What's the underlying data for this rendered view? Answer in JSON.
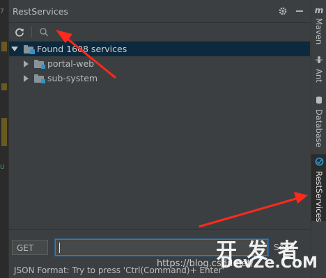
{
  "gutter": {
    "line_number": "7",
    "green_mark": "U"
  },
  "window": {
    "title": "RestServices"
  },
  "toolbar": {
    "refresh_icon": "refresh-icon",
    "search_icon": "search-icon"
  },
  "tree": {
    "root": "Found 1608 services",
    "children": [
      {
        "label": "portal-web"
      },
      {
        "label": "sub-system"
      }
    ]
  },
  "request": {
    "method": "GET",
    "url_value": "",
    "send_label": "Send"
  },
  "status": {
    "text": "JSON Format: Try to press 'Ctrl(Command)+ Enter'"
  },
  "rightbar": {
    "tabs": [
      {
        "label": "Maven",
        "icon": "maven-icon"
      },
      {
        "label": "Ant",
        "icon": "ant-icon"
      },
      {
        "label": "Database",
        "icon": "database-icon"
      },
      {
        "label": "RestServices",
        "icon": "rest-icon"
      }
    ]
  },
  "watermark": {
    "url": "https://blog.csdn.net/",
    "brand_cn": "开 发 者",
    "brand_en": "DevZe.CoM"
  },
  "colors": {
    "accent": "#3592c4",
    "selection": "#0d293e",
    "annotation": "#ff2a1a"
  }
}
